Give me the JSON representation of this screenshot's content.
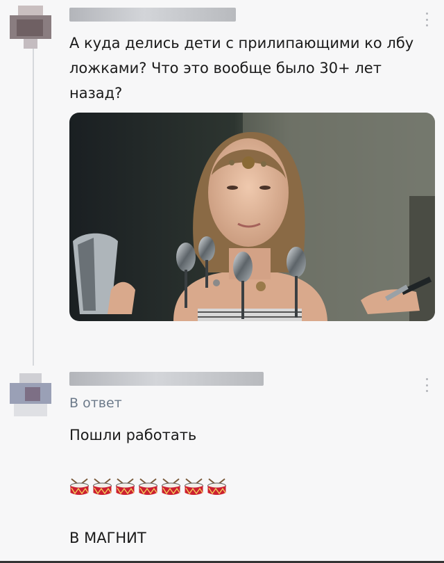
{
  "post": {
    "text": "А куда делись дети с прилипающими ко лбу ложками? Что это вообще было 30+ лет назад?"
  },
  "reply": {
    "reply_label": "В ответ",
    "text": "Пошли работать",
    "emoji_count": 7,
    "emoji_name": "drum-emoji",
    "final_text": "В МАГНИТ"
  },
  "icons": {
    "more": "vertical-ellipsis-icon",
    "drum": "drum-emoji"
  },
  "colors": {
    "background": "#f7f7f8",
    "reply_link": "#6c7a8a",
    "thread_line": "#d6d8dc",
    "drum_red": "#cc2030"
  }
}
